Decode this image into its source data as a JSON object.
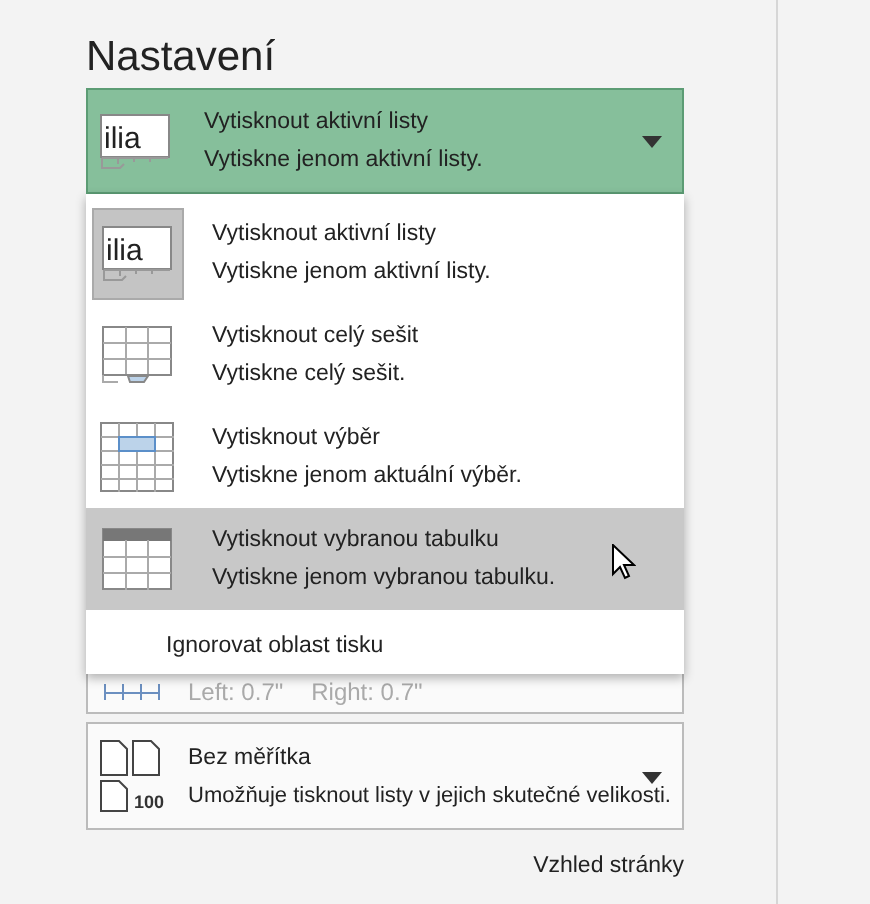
{
  "section_title": "Nastavení",
  "print_what": {
    "title": "Vytisknout aktivní listy",
    "description": "Vytiskne jenom aktivní listy.",
    "kind": "sheet",
    "icon_text": "ilia",
    "expanded": true
  },
  "menu": {
    "items": [
      {
        "kind": "sheet",
        "icon_text": "ilia",
        "title": "Vytisknout aktivní listy",
        "description": "Vytiskne jenom aktivní listy.",
        "selected": true,
        "hovered": false
      },
      {
        "kind": "workbook",
        "title": "Vytisknout celý sešit",
        "description": "Vytiskne celý sešit.",
        "selected": false,
        "hovered": false
      },
      {
        "kind": "selection",
        "title": "Vytisknout výběr",
        "description": "Vytiskne jenom aktuální výběr.",
        "selected": false,
        "hovered": false
      },
      {
        "kind": "table",
        "title": "Vytisknout vybranou tabulku",
        "description": "Vytiskne jenom vybranou tabulku.",
        "selected": false,
        "hovered": true
      }
    ],
    "ignore_print_area": {
      "label": "Ignorovat oblast tisku"
    }
  },
  "margins": {
    "left": "Left:  0.7\"",
    "right": "Right:  0.7\""
  },
  "scaling": {
    "title": "Bez měřítka",
    "description": "Umožňuje tisknout listy v jejich skutečné velikosti.",
    "badge": "100"
  },
  "page_setup_link": "Vzhled stránky"
}
